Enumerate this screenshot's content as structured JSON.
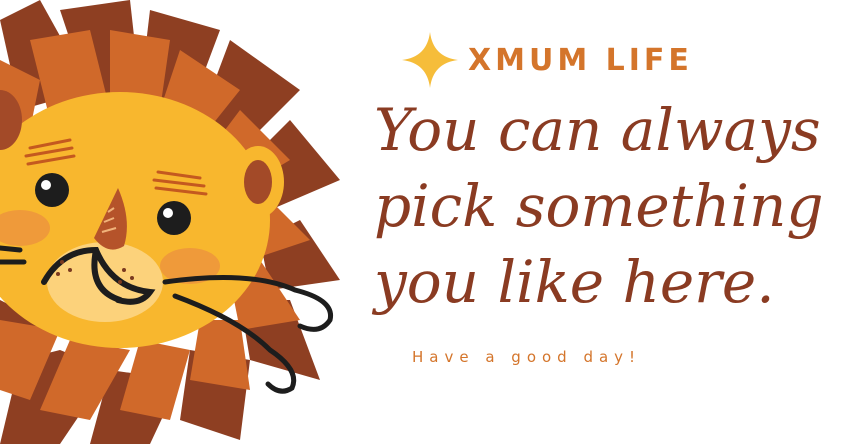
{
  "brand": {
    "name": "XMUM LIFE",
    "accent_color": "#d4752b",
    "star_color": "#f6bd3a",
    "icon": "four-point-star-icon"
  },
  "headline": {
    "line1": "You can always",
    "line2": "pick something",
    "line3": "you like here.",
    "color": "#8a3b22"
  },
  "tagline": "Have a good day!",
  "illustration": {
    "icon": "lion-face-icon",
    "colors": {
      "mane_dark": "#8e3f22",
      "mane_mid": "#d0692a",
      "face": "#f8b72e",
      "cheek": "#ef9a3a",
      "muzzle": "#fcd27b"
    }
  }
}
